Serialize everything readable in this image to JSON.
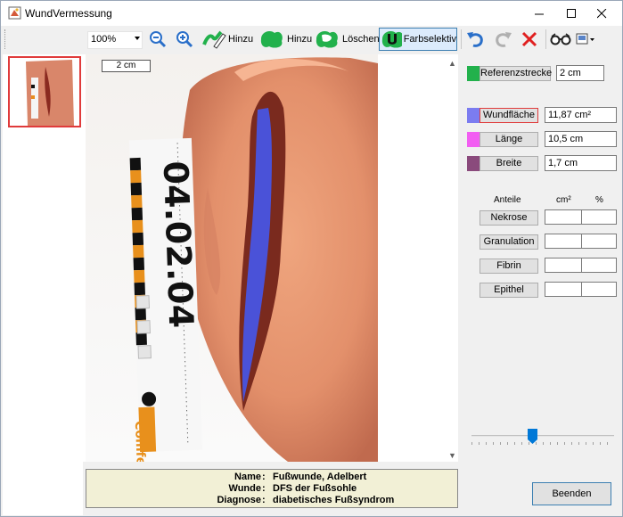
{
  "window": {
    "title": "WundVermessung",
    "minimize": "—",
    "maximize": "☐",
    "close": "✕"
  },
  "toolbar": {
    "zoom": "100%",
    "add1": "Hinzu",
    "add2": "Hinzu",
    "delete": "Löschen",
    "colorselect": "Farbselektiv"
  },
  "scale_label": "2 cm",
  "measure": {
    "ref_label": "Referenzstrecke",
    "ref_value": "2 cm",
    "ref_color": "#22b14c",
    "area_label": "Wundfläche",
    "area_value": "11,87 cm²",
    "area_color": "#7b7cf0",
    "length_label": "Länge",
    "length_value": "10,5 cm",
    "length_color": "#f25ef2",
    "width_label": "Breite",
    "width_value": "1,7 cm",
    "width_color": "#8a4a7c"
  },
  "tissue": {
    "header_name": "Anteile",
    "header_cm": "cm²",
    "header_pct": "%",
    "rows": [
      "Nekrose",
      "Granulation",
      "Fibrin",
      "Epithel"
    ]
  },
  "patient": {
    "name_key": "Name",
    "name_val": "Fußwunde, Adelbert",
    "wound_key": "Wunde",
    "wound_val": "DFS der Fußsohle",
    "diag_key": "Diagnose",
    "diag_val": "diabetisches Fußsyndrom",
    "colon": ":"
  },
  "photo_ruler_text": "04.02.04",
  "photo_brand": "Comfe",
  "close_button": "Beenden",
  "icons": [
    "app-icon",
    "zoom-out-icon",
    "zoom-in-icon",
    "pen-add-icon",
    "blob-add-icon",
    "blob-delete-icon",
    "magnet-icon",
    "undo-icon",
    "redo-icon",
    "cancel-icon",
    "glasses-icon",
    "image-menu-icon"
  ]
}
